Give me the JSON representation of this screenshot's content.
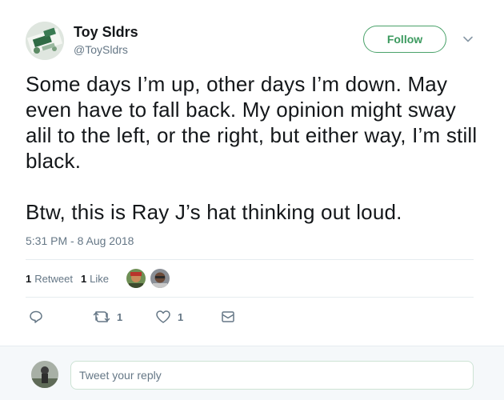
{
  "author": {
    "display_name": "Toy Sldrs",
    "handle": "@ToySldrs",
    "avatar_icon": "toy-soldiers-avatar"
  },
  "follow_label": "Follow",
  "accent_color": "#3c9a5f",
  "tweet": {
    "paragraph_1": "Some days I’m up, other days I’m down. May even have to fall back. My opinion might sway alil to the left, or the right, but either way, I’m still black.",
    "paragraph_2": "Btw, this is Ray J’s hat thinking out loud.",
    "timestamp": "5:31 PM - 8 Aug 2018"
  },
  "stats": {
    "retweet_count": "1",
    "retweet_label": "Retweet",
    "like_count": "1",
    "like_label": "Like"
  },
  "actions": {
    "reply_icon": "reply-icon",
    "retweet_icon": "retweet-icon",
    "retweet_count": "1",
    "like_icon": "heart-icon",
    "like_count": "1",
    "dm_icon": "envelope-icon"
  },
  "reply": {
    "placeholder": "Tweet your reply"
  }
}
